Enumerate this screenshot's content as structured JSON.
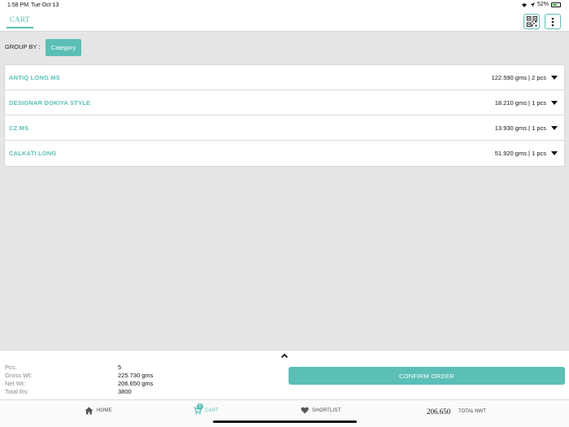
{
  "status_bar": {
    "time": "1:58 PM",
    "date": "Tue Oct 13",
    "battery": "52%"
  },
  "header": {
    "tab": "CART",
    "qr_icon": "qr-code-icon",
    "more_icon": "more-vertical-icon"
  },
  "group_by": {
    "label": "GROUP BY :",
    "button": "Category"
  },
  "items": [
    {
      "name": "ANTIQ LONG MS",
      "weight": "122.590 gms | 2 pcs"
    },
    {
      "name": "DESIGNAR DOKIYA STYLE",
      "weight": "18.210 gms | 1 pcs"
    },
    {
      "name": "CZ MS",
      "weight": "13.930 gms | 1 pcs"
    },
    {
      "name": "CALKATI LONG",
      "weight": "51.920 gms | 1 pcs"
    }
  ],
  "summary": {
    "pcs_label": "Pcs:",
    "pcs": "5",
    "gross_label": "Gross Wt:",
    "gross": "225.730 gms",
    "net_label": "Net Wt:",
    "net": "206.650 gms",
    "total_label": "Total Rs:",
    "total": "3800",
    "confirm": "CONFIRM ORDER"
  },
  "nav": {
    "home": "HOME",
    "cart": "CART",
    "cart_badge": "5",
    "shortlist": "SHORTLIST",
    "total_nwt_value": "206.650",
    "total_nwt_label": "TOTAL NWT"
  },
  "colors": {
    "accent": "#5bbfb6",
    "background": "#e5e5e5"
  }
}
